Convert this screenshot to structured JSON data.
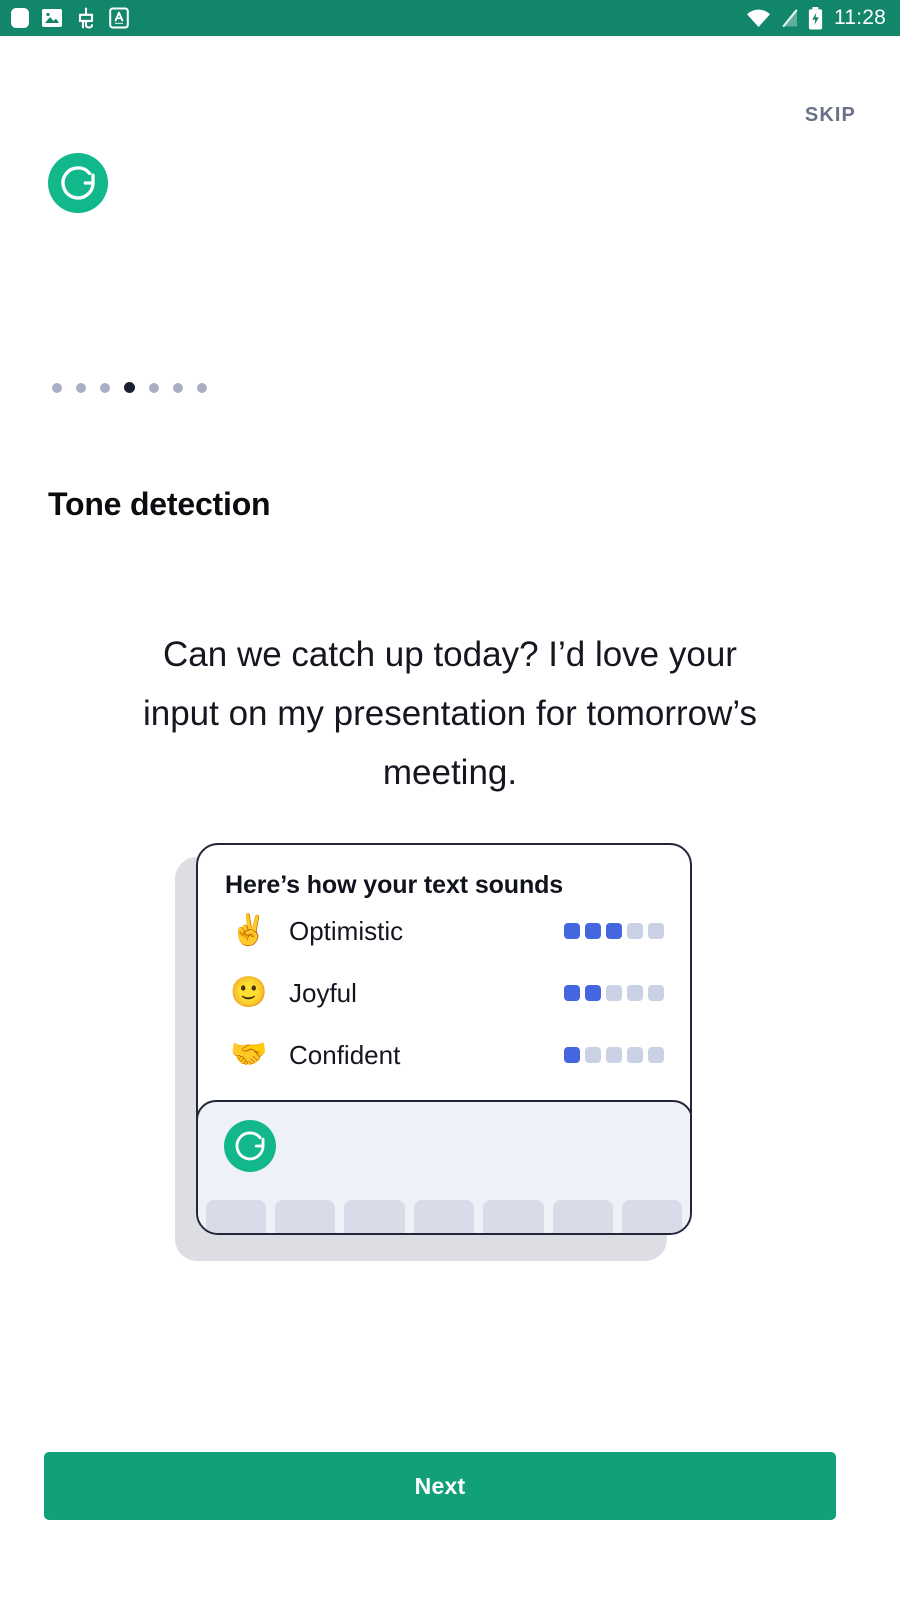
{
  "status_bar": {
    "background_color": "#12866b",
    "left_icons": [
      {
        "name": "app-badge-icon",
        "glyph": "rounded-square"
      },
      {
        "name": "photos-icon",
        "glyph": "image"
      },
      {
        "name": "cjk-input-icon",
        "glyph": "ime"
      },
      {
        "name": "text-input-icon",
        "glyph": "letter-a"
      }
    ],
    "right_icons": [
      {
        "name": "wifi-icon",
        "glyph": "wifi"
      },
      {
        "name": "cellular-signal-off-icon",
        "glyph": "signal-slash"
      },
      {
        "name": "battery-charging-icon",
        "glyph": "battery-bolt"
      }
    ],
    "clock": "11:28"
  },
  "header": {
    "skip_label": "SKIP",
    "brand_logo_name": "grammarly-logo",
    "brand_color": "#12b88c"
  },
  "pagination": {
    "total": 7,
    "active_index": 3,
    "active_color": "#1c2033",
    "inactive_color": "#a9aec4"
  },
  "main": {
    "title": "Tone detection",
    "sample_text": "Can we catch up today? I’d love your input on my presentation for tomorrow’s meeting.",
    "card": {
      "heading": "Here’s how your text sounds",
      "meter_max": 5,
      "active_pip_color": "#4467e0",
      "inactive_pip_color": "#cbd1e5",
      "tones": [
        {
          "emoji": "✌️",
          "emoji_name": "victory-hand-emoji",
          "label": "Optimistic",
          "score": 3
        },
        {
          "emoji": "🙂",
          "emoji_name": "slight-smile-emoji",
          "label": "Joyful",
          "score": 2
        },
        {
          "emoji": "🤝",
          "emoji_name": "handshake-emoji",
          "label": "Confident",
          "score": 1
        }
      ],
      "keyboard": {
        "logo_name": "grammarly-keyboard-logo",
        "background_color": "#eef1f8",
        "key_count": 7,
        "key_color": "#d8dbe8"
      }
    }
  },
  "footer": {
    "next_label": "Next",
    "next_color": "#12a07a"
  }
}
